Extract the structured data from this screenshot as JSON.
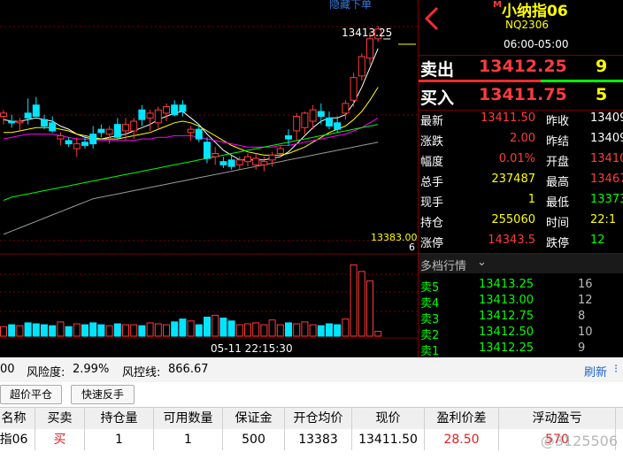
{
  "chart": {
    "hide_order_label": "隐藏下单",
    "last_price_label": "13413.25",
    "avg_price_label": "13383.00",
    "right_edge_label": "6",
    "cursor_time": "05-11 22:15:30",
    "colors": {
      "up": "#ff3b3b",
      "down": "#00e5ff",
      "ma1": "#ffffff",
      "ma2": "#ffff00",
      "ma3": "#ff00ff",
      "ma4": "#00ff00",
      "ma5": "#9a9a9a"
    }
  },
  "chart_data": {
    "type": "candlestick",
    "candles": [
      {
        "o": 13358,
        "h": 13362,
        "l": 13353,
        "c": 13360
      },
      {
        "o": 13355,
        "h": 13359,
        "l": 13351,
        "c": 13354
      },
      {
        "o": 13354,
        "h": 13357,
        "l": 13349,
        "c": 13355
      },
      {
        "o": 13360,
        "h": 13369,
        "l": 13353,
        "c": 13357
      },
      {
        "o": 13365,
        "h": 13370,
        "l": 13358,
        "c": 13358
      },
      {
        "o": 13356,
        "h": 13359,
        "l": 13350,
        "c": 13352
      },
      {
        "o": 13354,
        "h": 13358,
        "l": 13348,
        "c": 13349
      },
      {
        "o": 13344,
        "h": 13348,
        "l": 13340,
        "c": 13346
      },
      {
        "o": 13343,
        "h": 13345,
        "l": 13339,
        "c": 13341
      },
      {
        "o": 13338,
        "h": 13345,
        "l": 13333,
        "c": 13341
      },
      {
        "o": 13342,
        "h": 13346,
        "l": 13338,
        "c": 13340
      },
      {
        "o": 13347,
        "h": 13352,
        "l": 13338,
        "c": 13341
      },
      {
        "o": 13350,
        "h": 13353,
        "l": 13345,
        "c": 13348
      },
      {
        "o": 13347,
        "h": 13352,
        "l": 13341,
        "c": 13350
      },
      {
        "o": 13353,
        "h": 13357,
        "l": 13344,
        "c": 13345
      },
      {
        "o": 13349,
        "h": 13357,
        "l": 13343,
        "c": 13353
      },
      {
        "o": 13349,
        "h": 13357,
        "l": 13344,
        "c": 13355
      },
      {
        "o": 13362,
        "h": 13365,
        "l": 13352,
        "c": 13356
      },
      {
        "o": 13357,
        "h": 13362,
        "l": 13349,
        "c": 13360
      },
      {
        "o": 13354,
        "h": 13364,
        "l": 13350,
        "c": 13362
      },
      {
        "o": 13360,
        "h": 13366,
        "l": 13355,
        "c": 13364
      },
      {
        "o": 13365,
        "h": 13368,
        "l": 13358,
        "c": 13359
      },
      {
        "o": 13365,
        "h": 13368,
        "l": 13358,
        "c": 13361
      },
      {
        "o": 13348,
        "h": 13352,
        "l": 13343,
        "c": 13350
      },
      {
        "o": 13350,
        "h": 13353,
        "l": 13342,
        "c": 13344
      },
      {
        "o": 13342,
        "h": 13345,
        "l": 13329,
        "c": 13332
      },
      {
        "o": 13333,
        "h": 13339,
        "l": 13328,
        "c": 13335
      },
      {
        "o": 13330,
        "h": 13333,
        "l": 13326,
        "c": 13328
      },
      {
        "o": 13331,
        "h": 13334,
        "l": 13325,
        "c": 13327
      },
      {
        "o": 13328,
        "h": 13333,
        "l": 13325,
        "c": 13331
      },
      {
        "o": 13330,
        "h": 13335,
        "l": 13327,
        "c": 13333
      },
      {
        "o": 13328,
        "h": 13335,
        "l": 13325,
        "c": 13332
      },
      {
        "o": 13328,
        "h": 13333,
        "l": 13324,
        "c": 13330
      },
      {
        "o": 13331,
        "h": 13336,
        "l": 13327,
        "c": 13334
      },
      {
        "o": 13335,
        "h": 13340,
        "l": 13333,
        "c": 13338
      },
      {
        "o": 13346,
        "h": 13350,
        "l": 13340,
        "c": 13344
      },
      {
        "o": 13349,
        "h": 13360,
        "l": 13343,
        "c": 13358
      },
      {
        "o": 13351,
        "h": 13361,
        "l": 13347,
        "c": 13360
      },
      {
        "o": 13355,
        "h": 13365,
        "l": 13350,
        "c": 13362
      },
      {
        "o": 13361,
        "h": 13366,
        "l": 13353,
        "c": 13358
      },
      {
        "o": 13357,
        "h": 13361,
        "l": 13350,
        "c": 13352
      },
      {
        "o": 13354,
        "h": 13358,
        "l": 13348,
        "c": 13350
      },
      {
        "o": 13360,
        "h": 13368,
        "l": 13356,
        "c": 13366
      },
      {
        "o": 13368,
        "h": 13385,
        "l": 13364,
        "c": 13382
      },
      {
        "o": 13383,
        "h": 13397,
        "l": 13380,
        "c": 13395
      },
      {
        "o": 13394,
        "h": 13410,
        "l": 13390,
        "c": 13406
      },
      {
        "o": 13406,
        "h": 13414,
        "l": 13404,
        "c": 13412
      }
    ],
    "volume": [
      10,
      12,
      11,
      14,
      13,
      12,
      11,
      15,
      10,
      13,
      12,
      14,
      12,
      11,
      13,
      12,
      12,
      11,
      14,
      13,
      12,
      15,
      18,
      16,
      12,
      20,
      22,
      19,
      16,
      12,
      13,
      14,
      12,
      17,
      12,
      14,
      13,
      15,
      12,
      11,
      13,
      12,
      18,
      75,
      68,
      58,
      5
    ],
    "ma_series": [
      {
        "color": "#ffffff",
        "values": [
          13356,
          13355,
          13355,
          13356,
          13357,
          13356,
          13355,
          13352,
          13350,
          13347,
          13345,
          13344,
          13344,
          13345,
          13346,
          13347,
          13349,
          13351,
          13353,
          13356,
          13358,
          13360,
          13361,
          13357,
          13353,
          13347,
          13342,
          13337,
          13334,
          13331,
          13331,
          13331,
          13331,
          13332,
          13333,
          13336,
          13341,
          13346,
          13351,
          13355,
          13357,
          13357,
          13359,
          13366,
          13376,
          13388,
          13400
        ]
      },
      {
        "color": "#ffff00",
        "values": [
          13348,
          13348,
          13349,
          13350,
          13351,
          13351,
          13351,
          13350,
          13349,
          13347,
          13346,
          13345,
          13344,
          13344,
          13344,
          13345,
          13346,
          13347,
          13348,
          13350,
          13352,
          13354,
          13355,
          13354,
          13352,
          13349,
          13346,
          13343,
          13340,
          13338,
          13336,
          13335,
          13334,
          13334,
          13334,
          13335,
          13337,
          13339,
          13342,
          13345,
          13348,
          13350,
          13352,
          13356,
          13361,
          13368,
          13376
        ]
      },
      {
        "color": "#ff00ff",
        "values": [
          13344,
          13345,
          13346,
          13347,
          13347,
          13347,
          13347,
          13346,
          13345,
          13344,
          13344,
          13343,
          13343,
          13343,
          13343,
          13343,
          13343,
          13344,
          13344,
          13345,
          13345,
          13346,
          13346,
          13346,
          13345,
          13344,
          13343,
          13342,
          13341,
          13340,
          13339,
          13339,
          13339,
          13339,
          13340,
          13340,
          13341,
          13342,
          13343,
          13344,
          13345,
          13346,
          13347,
          13349,
          13351,
          13354,
          13357
        ]
      },
      {
        "color": "#00ff00",
        "values": [
          13306,
          13308,
          13309,
          13310,
          13311,
          13312,
          13313,
          13314,
          13315,
          13316,
          13317,
          13318,
          13319,
          13320,
          13321,
          13322,
          13323,
          13324,
          13325,
          13326,
          13327,
          13328,
          13329,
          13330,
          13331,
          13332,
          13333,
          13334,
          13335,
          13336,
          13337,
          13338,
          13339,
          13340,
          13341,
          13342,
          13343,
          13344,
          13345,
          13346,
          13347,
          13348,
          13349,
          13350,
          13351,
          13352,
          13353
        ]
      },
      {
        "color": "#9a9a9a",
        "values": [
          13285,
          13287,
          13289,
          13291,
          13293,
          13295,
          13297,
          13299,
          13301,
          13303,
          13305,
          13307,
          13308,
          13309,
          13310,
          13311,
          13312,
          13313,
          13314,
          13315,
          13316,
          13317,
          13318,
          13319,
          13320,
          13321,
          13322,
          13323,
          13324,
          13325,
          13326,
          13327,
          13328,
          13329,
          13330,
          13331,
          13332,
          13333,
          13334,
          13335,
          13336,
          13337,
          13338,
          13339,
          13340,
          13341,
          13342
        ]
      }
    ],
    "y_range": [
      13280,
      13430
    ],
    "volume_max": 80
  },
  "quote": {
    "back_icon": "chevron-left-icon",
    "title": "小纳指06",
    "title_prefix": "M",
    "code": "NQ2306",
    "session": "06:00-05:00",
    "sell_label": "卖出",
    "sell_price": "13412.25",
    "sell_qty": "9",
    "buy_label": "买入",
    "buy_price": "13411.75",
    "buy_qty": "5",
    "stats": [
      {
        "l1": "最新",
        "v1": "13411.50",
        "c1": "#ff3b3b",
        "l2": "昨收",
        "v2": "13409",
        "c2": "#ffffff"
      },
      {
        "l1": "涨跌",
        "v1": "2.00",
        "c1": "#ff3b3b",
        "l2": "昨结",
        "v2": "13409",
        "c2": "#ffffff"
      },
      {
        "l1": "幅度",
        "v1": "0.01%",
        "c1": "#ff3b3b",
        "l2": "开盘",
        "v2": "13410",
        "c2": "#ff3b3b"
      },
      {
        "l1": "总手",
        "v1": "237487",
        "c1": "#ffff00",
        "l2": "最高",
        "v2": "13467",
        "c2": "#ff3b3b"
      },
      {
        "l1": "现手",
        "v1": "1",
        "c1": "#ffff00",
        "l2": "最低",
        "v2": "13373",
        "c2": "#00ff00"
      },
      {
        "l1": "持仓",
        "v1": "255060",
        "c1": "#ffff00",
        "l2": "时间",
        "v2": "22:1",
        "c2": "#ffff00"
      },
      {
        "l1": "涨停",
        "v1": "14343.5",
        "c1": "#ff3b3b",
        "l2": "跌停",
        "v2": "12",
        "c2": "#00ff00"
      }
    ],
    "depth_title": "多档行情",
    "depth": [
      {
        "label": "卖5",
        "price": "13413.25",
        "qty": "16"
      },
      {
        "label": "卖4",
        "price": "13413.00",
        "qty": "12"
      },
      {
        "label": "卖3",
        "price": "13412.75",
        "qty": "8"
      },
      {
        "label": "卖2",
        "price": "13412.50",
        "qty": "10"
      },
      {
        "label": "卖1",
        "price": "13412.25",
        "qty": "9"
      }
    ]
  },
  "account": {
    "left_fragment": "00",
    "risk_label": "风险度:",
    "risk_value": "2.99%",
    "control_label": "风控线:",
    "control_value": "866.67",
    "refresh": "刷新",
    "buttons": [
      "超价平仓",
      "快速反手"
    ]
  },
  "positions": {
    "headers": [
      "名称",
      "买卖",
      "持仓量",
      "可用数量",
      "保证金",
      "开仓均价",
      "现价",
      "盈利价差",
      "浮动盈亏"
    ],
    "rows": [
      [
        "指06",
        "买",
        "1",
        "1",
        "500",
        "13383",
        "13411.50",
        "28.50",
        "570"
      ]
    ],
    "watermark": "@3125506"
  }
}
